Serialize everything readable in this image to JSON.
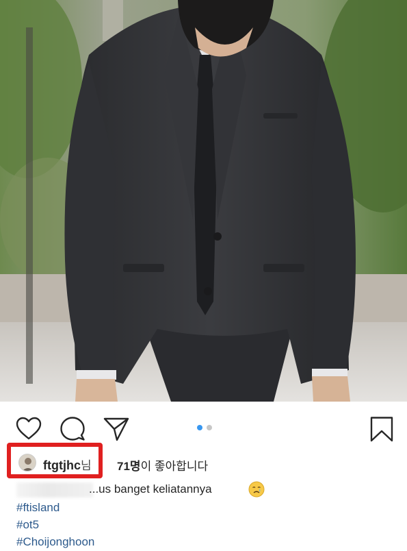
{
  "post": {
    "photo_alt": "",
    "account": {
      "username": "ftgtjhc",
      "honorific": "님"
    },
    "likes": {
      "count": "71명",
      "suffix": "이 좋아합니다"
    },
    "caption": {
      "text": "...us banget keliatannya"
    },
    "hashtags": [
      "#ftisland",
      "#ot5",
      "#Choijonghoon"
    ],
    "carousel": {
      "total": 2,
      "active_index": 0
    }
  },
  "icons": {
    "like": "heart-icon",
    "comment": "comment-bubble-icon",
    "share": "paper-plane-icon",
    "save": "bookmark-icon",
    "emoji": "crying-face-emoji-icon"
  },
  "colors": {
    "text": "#262626",
    "hashtag": "#2d5a8c",
    "carousel_active": "#3897f0",
    "carousel_inactive": "#c7c7c7",
    "highlight_box": "#e02020"
  }
}
